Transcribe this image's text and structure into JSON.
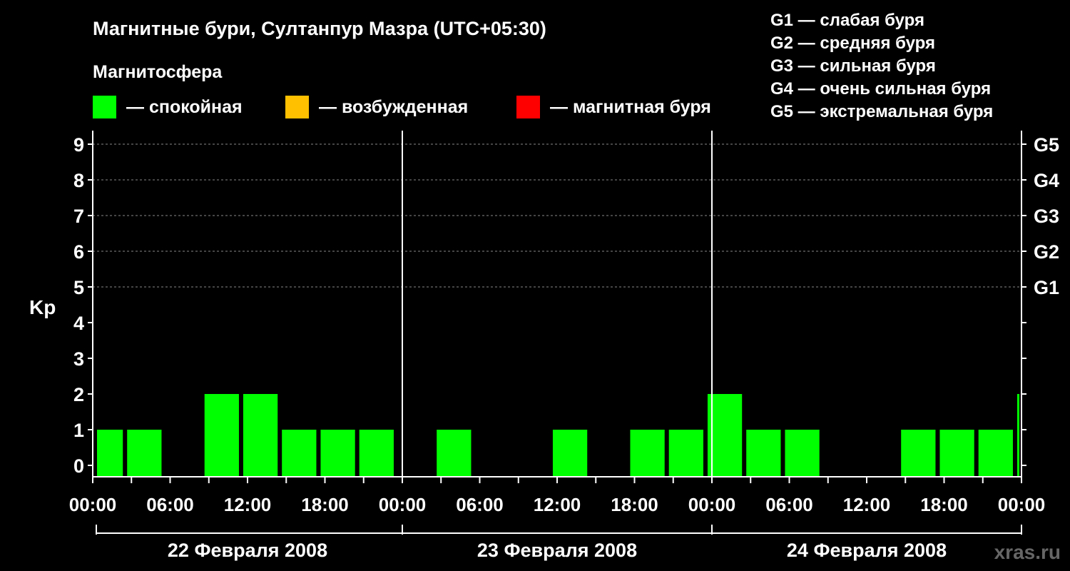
{
  "chart_data": {
    "type": "bar",
    "title": "Магнитные бури, Султанпур Мазра (UTC+05:30)",
    "ylabel": "Kp",
    "ylim": [
      0,
      9
    ],
    "yticks": [
      "0",
      "1",
      "2",
      "3",
      "4",
      "5",
      "6",
      "7",
      "8",
      "9"
    ],
    "g_scale": [
      {
        "kp": 5,
        "label": "G1"
      },
      {
        "kp": 6,
        "label": "G2"
      },
      {
        "kp": 7,
        "label": "G3"
      },
      {
        "kp": 8,
        "label": "G4"
      },
      {
        "kp": 9,
        "label": "G5"
      }
    ],
    "g_legend": [
      "G1 — слабая буря",
      "G2 — средняя буря",
      "G3 — сильная буря",
      "G4 — очень сильная буря",
      "G5 — экстремальная буря"
    ],
    "magnetosphere": {
      "title": "Магнитосфера",
      "items": [
        {
          "label": "— спокойная",
          "color": "#00ff00"
        },
        {
          "label": "— возбужденная",
          "color": "#ffc000"
        },
        {
          "label": "— магнитная буря",
          "color": "#ff0000"
        }
      ]
    },
    "x_tick_labels": [
      "00:00",
      "06:00",
      "12:00",
      "18:00",
      "00:00",
      "06:00",
      "12:00",
      "18:00",
      "00:00",
      "06:00",
      "12:00",
      "18:00",
      "00:00"
    ],
    "days": [
      "22 Февраля 2008",
      "23 Февраля 2008",
      "24 Февраля 2008"
    ],
    "x_unit": "hours",
    "bars": [
      {
        "start": 0,
        "end": 2.5,
        "value": 1,
        "color": "#00ff00"
      },
      {
        "start": 2.5,
        "end": 5.5,
        "value": 1,
        "color": "#00ff00"
      },
      {
        "start": 8.5,
        "end": 11.5,
        "value": 2,
        "color": "#00ff00"
      },
      {
        "start": 11.5,
        "end": 14.5,
        "value": 2,
        "color": "#00ff00"
      },
      {
        "start": 14.5,
        "end": 17.5,
        "value": 1,
        "color": "#00ff00"
      },
      {
        "start": 17.5,
        "end": 20.5,
        "value": 1,
        "color": "#00ff00"
      },
      {
        "start": 20.5,
        "end": 23.5,
        "value": 1,
        "color": "#00ff00"
      },
      {
        "start": 26.5,
        "end": 29.5,
        "value": 1,
        "color": "#00ff00"
      },
      {
        "start": 35.5,
        "end": 38.5,
        "value": 1,
        "color": "#00ff00"
      },
      {
        "start": 41.5,
        "end": 44.5,
        "value": 1,
        "color": "#00ff00"
      },
      {
        "start": 44.5,
        "end": 47.5,
        "value": 1,
        "color": "#00ff00"
      },
      {
        "start": 47.5,
        "end": 50.5,
        "value": 2,
        "color": "#00ff00"
      },
      {
        "start": 50.5,
        "end": 53.5,
        "value": 1,
        "color": "#00ff00"
      },
      {
        "start": 53.5,
        "end": 56.5,
        "value": 1,
        "color": "#00ff00"
      },
      {
        "start": 62.5,
        "end": 65.5,
        "value": 1,
        "color": "#00ff00"
      },
      {
        "start": 65.5,
        "end": 68.5,
        "value": 1,
        "color": "#00ff00"
      },
      {
        "start": 68.5,
        "end": 71.5,
        "value": 1,
        "color": "#00ff00"
      },
      {
        "start": 71.5,
        "end": 72,
        "value": 2,
        "color": "#00ff00"
      }
    ],
    "grid": true,
    "watermark": "xras.ru"
  }
}
